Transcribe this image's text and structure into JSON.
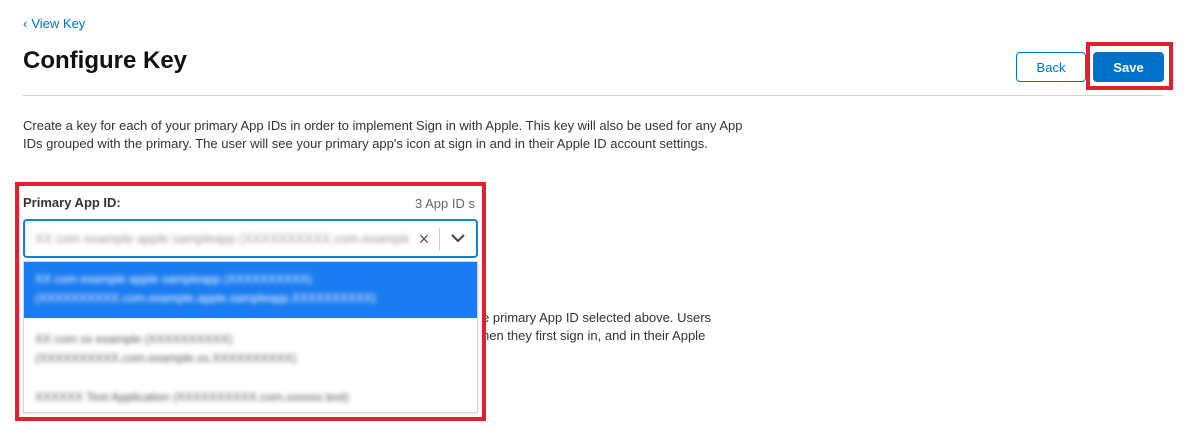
{
  "nav": {
    "back_link_label": "View Key"
  },
  "header": {
    "title": "Configure Key",
    "back_button": "Back",
    "save_button": "Save"
  },
  "description": "Create a key for each of your primary App IDs in order to implement Sign in with Apple. This key will also be used for any App IDs grouped with the primary. The user will see your primary app's icon at sign in and in their Apple ID account settings.",
  "field": {
    "label": "Primary App ID:",
    "count_text": "3 App ID s",
    "selected_value": "XX com example apple sampleapp (XXXXXXXXXX.com.example.apple...)"
  },
  "behind_text": {
    "line1": "e primary App ID selected above. Users",
    "line2": "hen they first sign in, and in their Apple"
  },
  "dropdown": {
    "options": [
      {
        "line1": "XX com example apple sampleapp (XXXXXXXXXX)",
        "line2": "(XXXXXXXXXX.com.example.apple.sampleapp.XXXXXXXXXX)"
      },
      {
        "line1": "XX com xx example (XXXXXXXXXX)",
        "line2": "(XXXXXXXXXX.com.example.xx.XXXXXXXXXX)"
      },
      {
        "line1": "XXXXXX Test Application (XXXXXXXXXX.com.xxxxxx.test)"
      }
    ]
  },
  "colors": {
    "accent": "#0070c9",
    "highlight": "#e0202e",
    "selected_option": "#1a7cf0"
  }
}
